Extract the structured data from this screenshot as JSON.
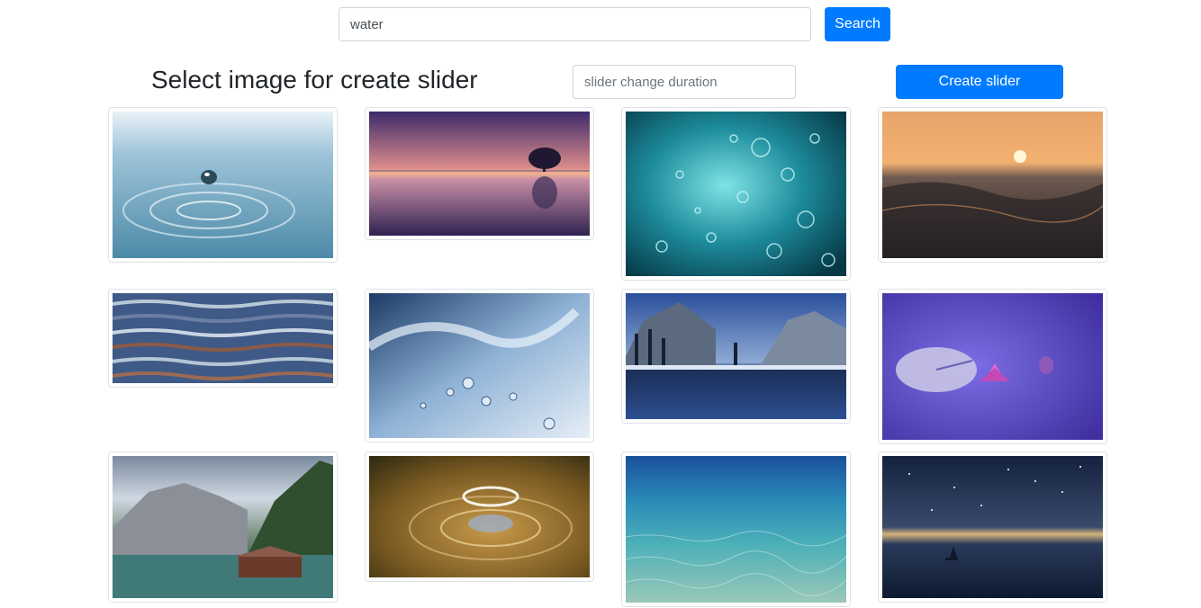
{
  "search": {
    "value": "water",
    "button_label": "Search"
  },
  "slider_form": {
    "title": "Select image for create slider",
    "duration_placeholder": "slider change duration",
    "create_label": "Create slider"
  },
  "images": [
    {
      "subject": "water droplet ripple"
    },
    {
      "subject": "purple sunset lake with tree"
    },
    {
      "subject": "underwater bubbles"
    },
    {
      "subject": "sunset over ocean waves"
    },
    {
      "subject": "rippled water surface"
    },
    {
      "subject": "water splash"
    },
    {
      "subject": "snowy mountain lake reflection"
    },
    {
      "subject": "lotus flower on purple water"
    },
    {
      "subject": "mountain lake with boathouse"
    },
    {
      "subject": "golden water droplet splash"
    },
    {
      "subject": "clear shallow sea water"
    },
    {
      "subject": "starry night sea with boat"
    }
  ]
}
